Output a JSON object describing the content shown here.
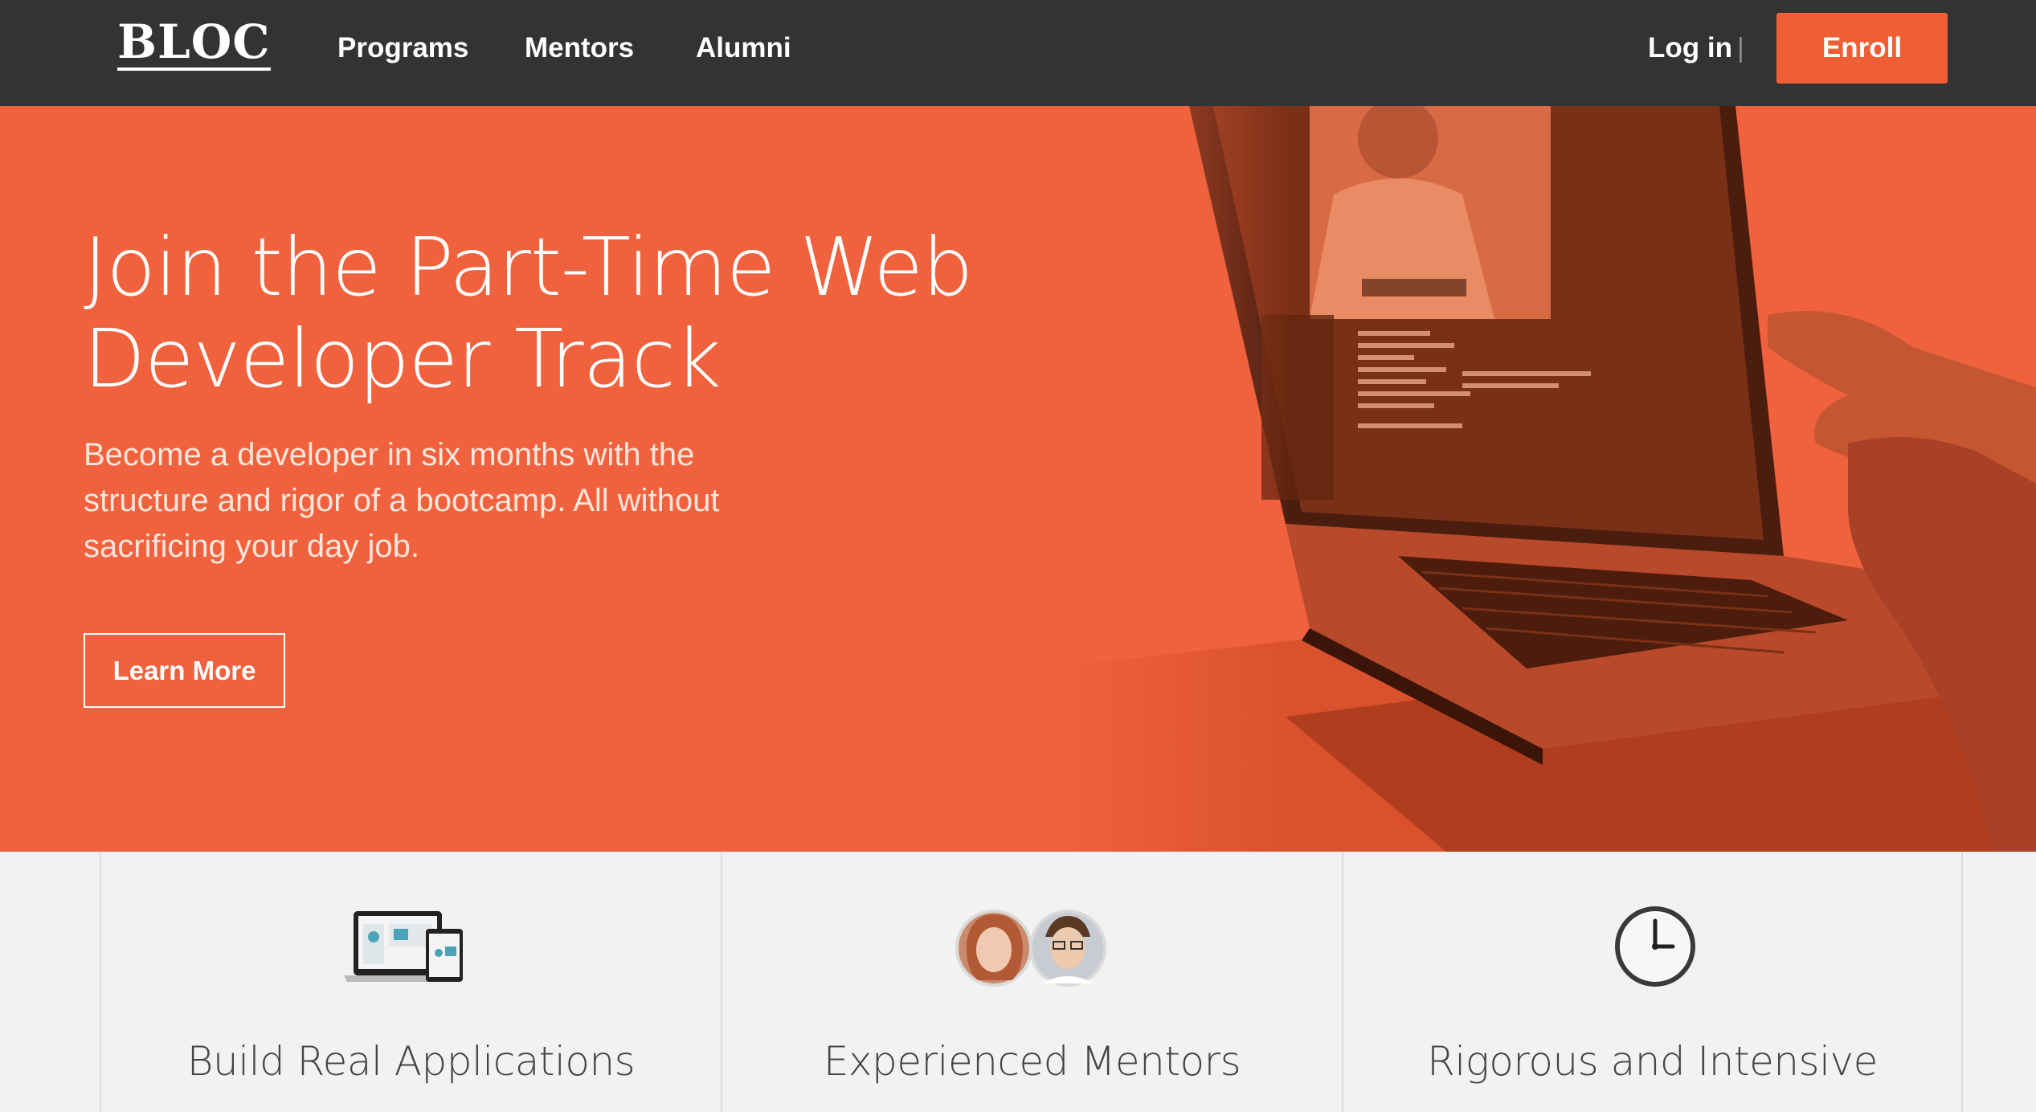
{
  "nav": {
    "logo": "BLOC",
    "links": [
      "Programs",
      "Mentors",
      "Alumni"
    ],
    "login": "Log in",
    "separator": "|",
    "enroll": "Enroll"
  },
  "hero": {
    "title_line1": "Join the Part-Time Web",
    "title_line2": "Developer Track",
    "subtitle_line1": "Become a developer in six months with the",
    "subtitle_line2": "structure and rigor of a bootcamp. All without",
    "subtitle_line3": "sacrificing your day job.",
    "cta": "Learn More"
  },
  "features": [
    {
      "title": "Build Real Applications",
      "icon": "devices-icon"
    },
    {
      "title": "Experienced Mentors",
      "icon": "mentor-avatars-icon"
    },
    {
      "title": "Rigorous and Intensive",
      "icon": "clock-icon"
    }
  ],
  "colors": {
    "nav_bg": "#333333",
    "accent": "#ef5e34",
    "hero_bg": "#f0623e",
    "feature_bg": "#f2f2f2"
  }
}
